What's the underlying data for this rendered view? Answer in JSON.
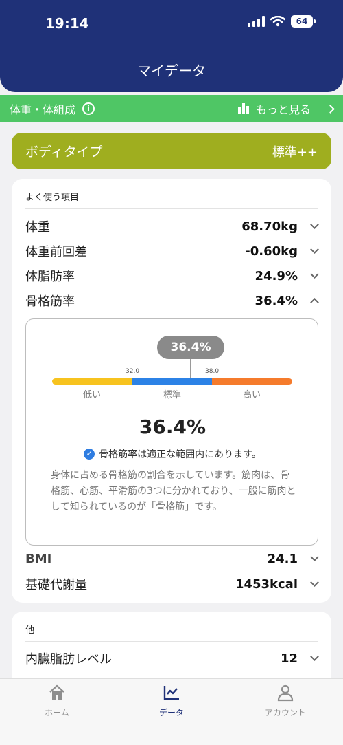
{
  "status_bar": {
    "time": "19:14",
    "battery": "64"
  },
  "header": {
    "title": "マイデータ"
  },
  "subheader": {
    "label": "体重・体組成",
    "more_label": "もっと見る"
  },
  "body_type": {
    "label": "ボディタイプ",
    "value": "標準++"
  },
  "frequent": {
    "title": "よく使う項目",
    "rows": [
      {
        "label": "体重",
        "value": "68.70kg"
      },
      {
        "label": "体重前回差",
        "value": "-0.60kg"
      },
      {
        "label": "体脂肪率",
        "value": "24.9%"
      },
      {
        "label": "骨格筋率",
        "value": "36.4%"
      }
    ],
    "rows_after": [
      {
        "label": "BMI",
        "value": "24.1"
      },
      {
        "label": "基礎代謝量",
        "value": "1453kcal"
      }
    ]
  },
  "detail": {
    "bubble": "36.4%",
    "value_percent": 36.4,
    "thresholds": [
      "32.0",
      "38.0"
    ],
    "levels": [
      "低い",
      "標準",
      "高い"
    ],
    "level_colors": [
      "#f7c31f",
      "#2c82e6",
      "#f57b2c"
    ],
    "big_value": "36.4%",
    "status_text": "骨格筋率は適正な範囲内にあります。",
    "description": "身体に占める骨格筋の割合を示しています。筋肉は、骨格筋、心筋、平滑筋の3つに分かれており、一般に筋肉として知られているのが「骨格筋」です。"
  },
  "other": {
    "title": "他",
    "rows": [
      {
        "label": "内臓脂肪レベル",
        "value": "12"
      }
    ]
  },
  "tabs": [
    {
      "label": "ホーム",
      "icon": "home-icon"
    },
    {
      "label": "データ",
      "icon": "chart-icon"
    },
    {
      "label": "アカウント",
      "icon": "account-icon"
    }
  ],
  "colors": {
    "header": "#1f3178",
    "green": "#4fc665",
    "olive": "#9fae1f"
  }
}
